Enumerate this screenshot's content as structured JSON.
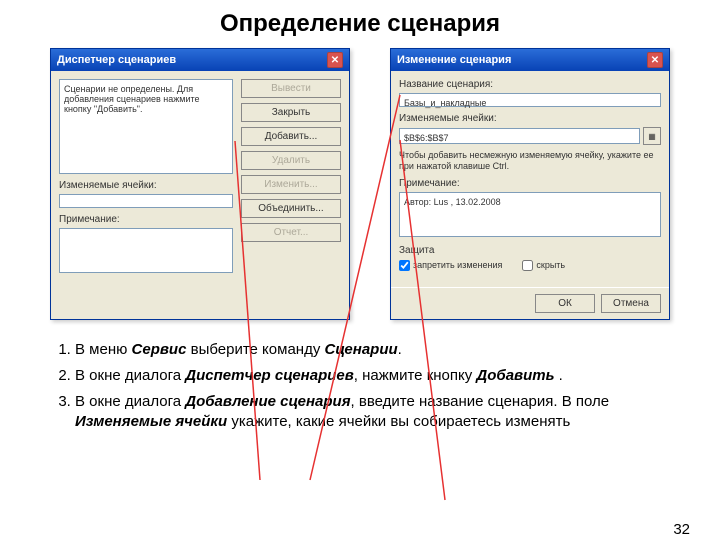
{
  "title": "Определение сценария",
  "page_number": "32",
  "dialog1": {
    "title": "Диспетчер сценариев",
    "scenarios_label": "Сценарии не определены. Для добавления сценариев нажмите кнопку \"Добавить\".",
    "cells_label": "Изменяемые ячейки:",
    "note_label": "Примечание:",
    "btn_show": "Вывести",
    "btn_close": "Закрыть",
    "btn_add": "Добавить...",
    "btn_delete": "Удалить",
    "btn_edit": "Изменить...",
    "btn_merge": "Объединить...",
    "btn_report": "Отчет..."
  },
  "dialog2": {
    "title": "Изменение сценария",
    "name_label": "Название сценария:",
    "name_value": "Базы_и_накладные",
    "cells_label": "Изменяемые ячейки:",
    "cells_value": "$B$6:$B$7",
    "hint": "Чтобы добавить несмежную изменяемую ячейку, укажите ее при нажатой клавише Ctrl.",
    "note_label": "Примечание:",
    "note_value": "Автор: Lus , 13.02.2008",
    "protect_label": "Защита",
    "chk_prevent": "запретить изменения",
    "chk_hide": "скрыть",
    "btn_ok": "ОК",
    "btn_cancel": "Отмена"
  },
  "instructions": {
    "i1a": "В меню ",
    "i1b": "Сервис",
    "i1c": "  выберите команду ",
    "i1d": "Сценарии",
    "i1e": ".",
    "i2a": " В окне диалога ",
    "i2b": "Диспетчер сценариев",
    "i2c": ", нажмите кнопку ",
    "i2d": "Добавить",
    "i2e": " .",
    "i3a": " В окне диалога ",
    "i3b": "Добавление сценария",
    "i3c": ", введите название сценария. В поле ",
    "i3d": "Изменяемые ячейки",
    "i3e": "  укажите, какие ячейки вы собираетесь изменять"
  }
}
